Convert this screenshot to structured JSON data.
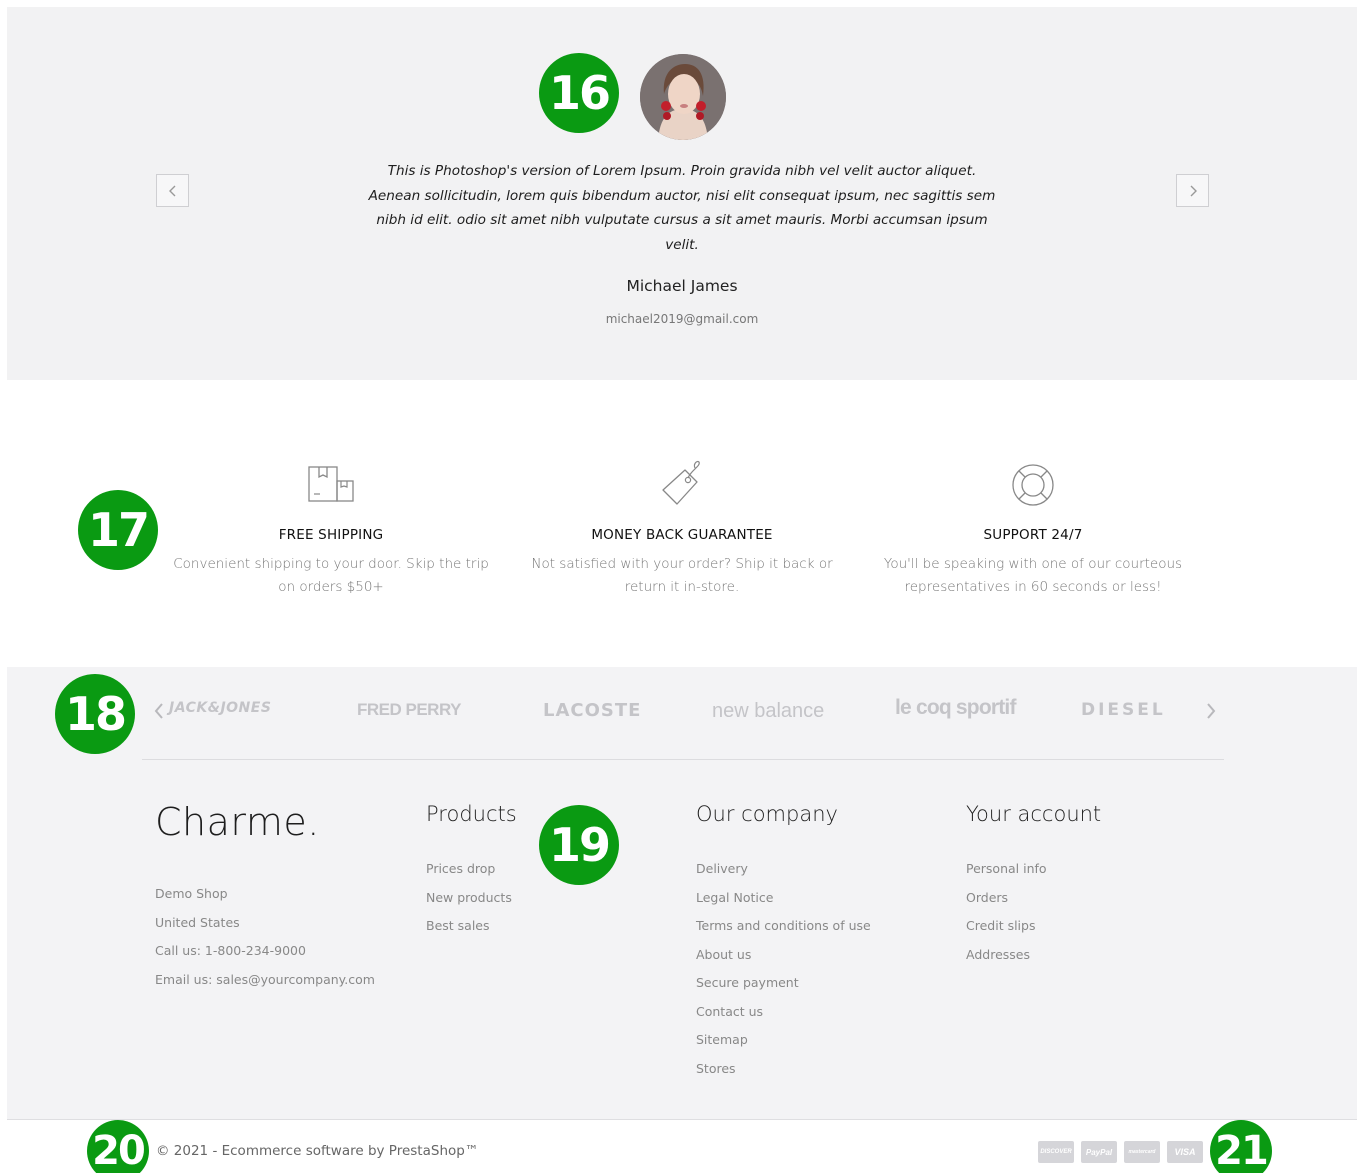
{
  "markers": [
    "16",
    "17",
    "18",
    "19",
    "20",
    "21"
  ],
  "testimonial": {
    "quote": "This is Photoshop's version of Lorem Ipsum. Proin gravida nibh vel velit auctor aliquet. Aenean sollicitudin, lorem quis bibendum auctor, nisi elit consequat ipsum, nec sagittis sem nibh id elit. odio sit amet nibh vulputate cursus a sit amet mauris. Morbi accumsan ipsum velit.",
    "name": "Michael James",
    "email": "michael2019@gmail.com",
    "prev_icon": "chevron-left-icon",
    "next_icon": "chevron-right-icon"
  },
  "features": [
    {
      "icon": "package-icon",
      "title": "FREE SHIPPING",
      "desc_line1": "Convenient shipping to your door. Skip the trip",
      "desc_line2": "on orders $50+"
    },
    {
      "icon": "price-tag-icon",
      "title": "MONEY BACK GUARANTEE",
      "desc_line1": "Not satisfied with your order? Ship it back or",
      "desc_line2": "return it in-store."
    },
    {
      "icon": "lifebuoy-icon",
      "title": "SUPPORT 24/7",
      "desc_line1": "You'll be speaking with one of our courteous",
      "desc_line2": "representatives in 60 seconds or less!"
    }
  ],
  "brands": [
    "JACK&JONES",
    "FRED PERRY",
    "LACOSTE",
    "new balance",
    "le coq sportif",
    "DIESEL"
  ],
  "footer": {
    "logo": "Charme.",
    "shop": [
      "Demo Shop",
      "United States",
      "Call us: 1-800-234-9000",
      "Email us: sales@yourcompany.com"
    ],
    "products": {
      "title": "Products",
      "links": [
        "Prices drop",
        "New products",
        "Best sales"
      ]
    },
    "company": {
      "title": "Our company",
      "links": [
        "Delivery",
        "Legal Notice",
        "Terms and conditions of use",
        "About us",
        "Secure payment",
        "Contact us",
        "Sitemap",
        "Stores"
      ]
    },
    "account": {
      "title": "Your account",
      "links": [
        "Personal info",
        "Orders",
        "Credit slips",
        "Addresses"
      ]
    },
    "copyright": "© 2021 - Ecommerce software by PrestaShop™",
    "payments": [
      "DISCOVER",
      "PayPal",
      "mastercard",
      "VISA"
    ]
  },
  "colors": {
    "marker": "#0a9a12",
    "testimonial_bg": "#f2f2f3",
    "brands_bg": "#f3f3f5"
  }
}
